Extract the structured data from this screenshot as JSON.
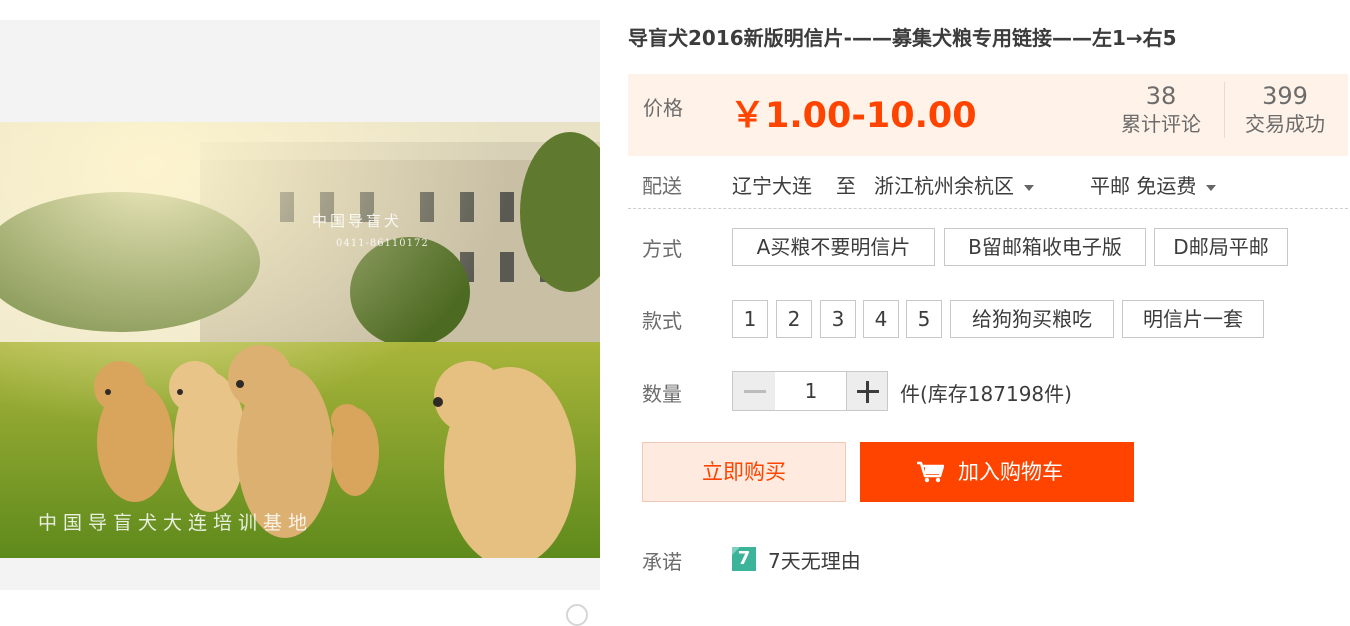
{
  "product": {
    "title": "导盲犬2016新版明信片-——募集犬粮专用链接——左1→右5",
    "image_watermarks": {
      "top": "中国导盲犬",
      "phone": "0411-86110172",
      "bottom": "中国导盲犬大连培训基地"
    }
  },
  "price": {
    "label": "价格",
    "value": "￥1.00-10.00",
    "reviews_count": "38",
    "reviews_label": "累计评论",
    "sales_count": "399",
    "sales_label": "交易成功"
  },
  "shipping": {
    "label": "配送",
    "from": "辽宁大连",
    "to_word": "至",
    "destination": "浙江杭州余杭区",
    "method": "平邮 免运费"
  },
  "options": {
    "mode_label": "方式",
    "modes": [
      "A买粮不要明信片",
      "B留邮箱收电子版",
      "D邮局平邮"
    ],
    "style_label": "款式",
    "styles": [
      "1",
      "2",
      "3",
      "4",
      "5",
      "给狗狗买粮吃",
      "明信片一套"
    ]
  },
  "quantity": {
    "label": "数量",
    "value": "1",
    "stock_text": "件(库存187198件)"
  },
  "actions": {
    "buy_now": "立即购买",
    "add_to_cart": "加入购物车"
  },
  "promise": {
    "label": "承诺",
    "icon_glyph": "7",
    "text": "7天无理由"
  },
  "colors": {
    "accent": "#ff4400",
    "price_bg": "#fff2e8",
    "promise_icon": "#3cb499"
  }
}
